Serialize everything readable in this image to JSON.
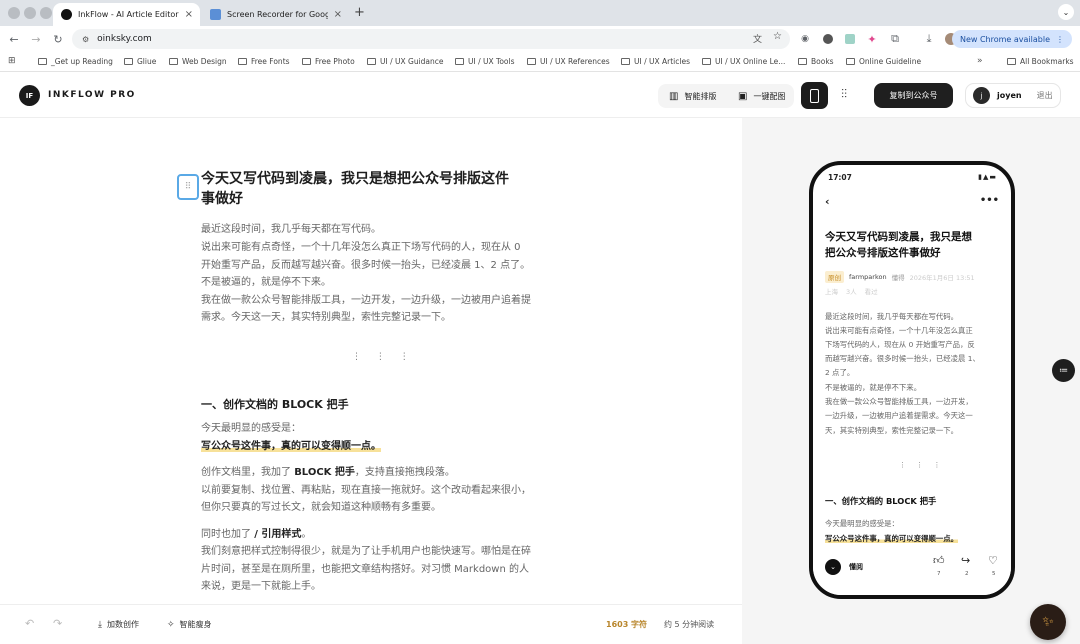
{
  "browser": {
    "tabs": [
      {
        "title": "InkFlow - AI Article Editor",
        "active": true
      },
      {
        "title": "Screen Recorder for Google C",
        "active": false
      }
    ],
    "url": "oinksky.com",
    "new_chrome_label": "New Chrome available",
    "bookmarks": [
      "_Get up Reading",
      "Gliue",
      "Web Design",
      "Free Fonts",
      "Free Photo",
      "UI / UX Guidance",
      "UI / UX Tools",
      "UI / UX References",
      "UI / UX Articles",
      "UI / UX Online Le...",
      "Books",
      "Online Guideline"
    ],
    "all_bookmarks": "All Bookmarks"
  },
  "app": {
    "logo_initials": "IF",
    "brand": "INKFLOW PRO",
    "smart_layout": "智能排版",
    "one_click_image": "一键配图",
    "copy_to_wechat": "复制到公众号",
    "user_initial": "j",
    "username": "joyen",
    "logout": "退出"
  },
  "editor": {
    "title_line1": "今天又写代码到凌晨，我只是想把公众号排版这件",
    "title_line2": "事做好",
    "paragraphs": [
      "最近这段时间，我几乎每天都在写代码。",
      "说出来可能有点奇怪，一个十几年没怎么真正下场写代码的人，现在从 0",
      "开始重写产品，反而越写越兴奋。很多时候一抬头，已经凌晨 1、2 点了。",
      "不是被逼的，就是停不下来。",
      "我在做一款公众号智能排版工具，一边开发，一边升级，一边被用户追着提",
      "需求。今天这一天，其实特别典型，索性完整记录一下。"
    ],
    "divider": "⋮ ⋮ ⋮",
    "section1_heading": "一、创作文档的 BLOCK 把手",
    "s1_intro": "今天最明显的感受是：",
    "s1_highlight": "写公众号这件事，真的可以变得顺一点。",
    "s1_p1_a": "创作文档里，我加了 ",
    "s1_p1_bold": "BLOCK 把手",
    "s1_p1_b": "，支持直接拖拽段落。",
    "s1_p2": "以前要复制、找位置、再粘贴，现在直接一拖就好。这个改动看起来很小，",
    "s1_p3": "但你只要真的写过长文，就会知道这种顺畅有多重要。",
    "s1_p4_a": "同时也加了 ",
    "s1_p4_bold": "/ 引用样式",
    "s1_p4_b": "。",
    "s1_p5": "我们刻意把样式控制得很少，就是为了让手机用户也能快速写。哪怕是在碎",
    "s1_p6": "片时间，甚至是在厕所里，也能把文章结构搭好。对习惯 Markdown 的人",
    "s1_p7": "来说，更是一下就能上手。"
  },
  "footer": {
    "add_creation": "加数创作",
    "smart_slim": "智能瘦身",
    "char_count": "1603 字符",
    "read_time": "约 5 分钟阅读"
  },
  "phone": {
    "time": "17:07",
    "title_line1": "今天又写代码到凌晨，我只是想",
    "title_line2": "把公众号排版这件事做好",
    "tag": "原创",
    "author": "farmparkon",
    "author_note": "懂得",
    "date": "2026年1月6日 13:51",
    "location": "上海",
    "meta_extra_1": "3人",
    "meta_extra_2": "看过",
    "paragraphs": [
      "最近这段时间，我几乎每天都在写代码。",
      "说出来可能有点奇怪，一个十几年没怎么真正",
      "下场写代码的人，现在从 0 开始重写产品，反",
      "而越写越兴奋。很多时候一抬头，已经凌晨 1、",
      "2 点了。",
      "不是被逼的，就是停不下来。",
      "我在做一款公众号智能排版工具，一边开发，",
      "一边升级，一边被用户追着提需求。今天这一",
      "天，其实特别典型，索性完整记录一下。"
    ],
    "divider": "⋮ ⋮ ⋮",
    "section1_heading": "一、创作文档的 BLOCK 把手",
    "s1_intro": "今天最明显的感受是：",
    "s1_highlight": "写公众号这件事，真的可以变得顺一点。",
    "bottom_name": "懂阅",
    "like_count": "7",
    "share_count": "2",
    "heart_count": "5"
  }
}
